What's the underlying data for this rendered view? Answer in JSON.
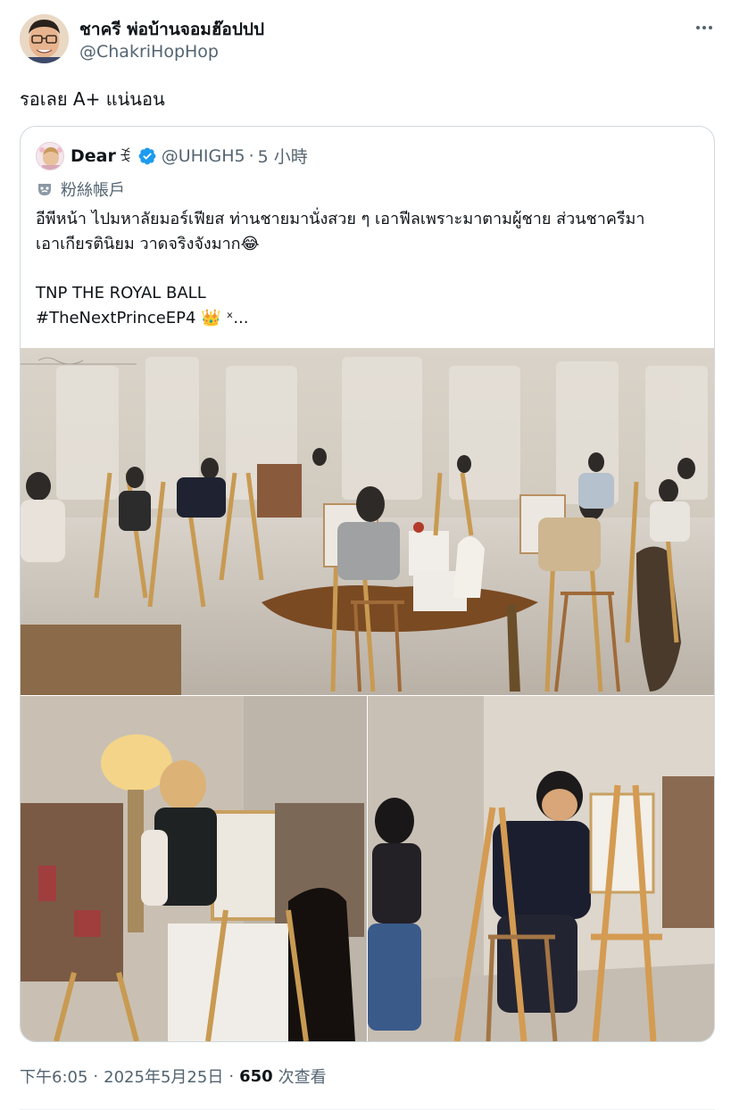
{
  "author": {
    "name": "ชาครี พ่อบ้านจอมฮ๊อปปป",
    "handle": "@ChakriHopHop"
  },
  "tweet": {
    "text": "รอเลย A+ แน่นอน"
  },
  "quoted": {
    "name": "Dear",
    "name_emoji": "ꉂ ",
    "verified_icon": "verified-badge-icon",
    "handle": "@UHIGH5",
    "separator": "·",
    "time": "5 小時",
    "account_label": "粉絲帳戶",
    "body_lines": [
      "อีพีหน้า ไปมหาลัยมอร์เฟียส ท่านชายมานั่งสวย ๆ เอาฟีลเพราะมาตามผู้ชาย ส่วนชาครีมา",
      "เอาเกียรตินิยม วาดจริงจังมาก😂",
      "",
      "TNP THE ROYAL BALL",
      "#TheNextPrinceEP4 👑 ˣ..."
    ],
    "media": [
      "art-class-wide-photo",
      "art-class-student-photo",
      "art-class-painter-photo"
    ]
  },
  "meta": {
    "time": "下午6:05",
    "dot1": "·",
    "date": "2025年5月25日",
    "dot2": "·",
    "views_count": "650",
    "views_label": "次查看"
  },
  "colors": {
    "text_primary": "#0f1419",
    "text_secondary": "#536471",
    "border": "#cfd9de",
    "verified": "#1d9bf0"
  }
}
